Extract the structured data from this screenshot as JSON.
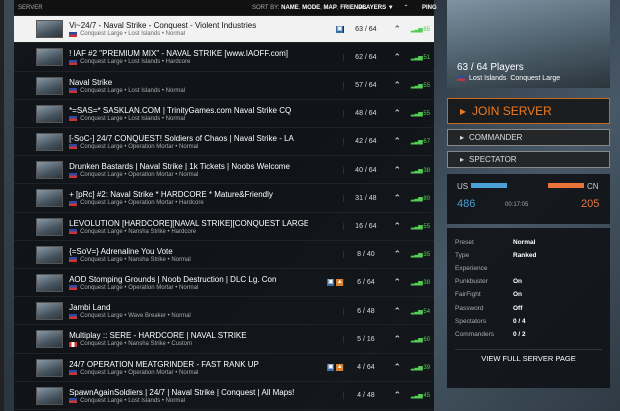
{
  "header": {
    "server_label": "SERVER",
    "sort_by": "SORT BY:",
    "sort_options": [
      "NAME",
      "MODE",
      "MAP",
      "FRIENDS"
    ],
    "players_label": "PLAYERS ▼",
    "ping_label": "PING"
  },
  "servers": [
    {
      "name": "Vi~24/7 - Naval Strike - Conquest - Violent Industries",
      "sub": "Conquest Large • Lost Islands • Normal",
      "players": "63 / 64",
      "ping": "85",
      "icons": [
        "b"
      ],
      "flag": "us"
    },
    {
      "name": "! IAF #2 \"PREMIUM MIX\" - NAVAL STRIKE [www.IAOFF.com]",
      "sub": "Conquest Large • Lost Islands • Hardcore",
      "players": "62 / 64",
      "ping": "51",
      "icons": [],
      "flag": "us"
    },
    {
      "name": "Naval Strike",
      "sub": "Conquest Large • Lost Islands • Normal",
      "players": "57 / 64",
      "ping": "55",
      "icons": [],
      "flag": "us"
    },
    {
      "name": "*=SAS=* SASKLAN.COM | TrinityGames.com Naval Strike CQ",
      "sub": "Conquest Large • Lost Islands • Normal",
      "players": "48 / 64",
      "ping": "55",
      "icons": [],
      "flag": "us"
    },
    {
      "name": "[-SoC-] 24/7 CONQUEST! Soldiers of Chaos | Naval Strike - LA",
      "sub": "Conquest Large • Operation Mortar • Normal",
      "players": "42 / 64",
      "ping": "67",
      "icons": [],
      "flag": "us"
    },
    {
      "name": "Drunken Bastards | Naval Strike | 1k Tickets | Noobs Welcome",
      "sub": "Conquest Large • Operation Mortar • Normal",
      "players": "40 / 64",
      "ping": "38",
      "icons": [],
      "flag": "us"
    },
    {
      "name": "+ [pRc] #2: Naval Strike * HARDCORE * Mature&Friendly",
      "sub": "Conquest Large • Operation Mortar • Hardcore",
      "players": "31 / 48",
      "ping": "80",
      "icons": [],
      "flag": "us"
    },
    {
      "name": "LEVOLUTION [HARDCORE][NAVAL STRIKE][CONQUEST LARGE]",
      "sub": "Conquest Large • Nansha Strike • Hardcore",
      "players": "16 / 64",
      "ping": "55",
      "icons": [],
      "flag": "us"
    },
    {
      "name": "{=SoV=} Adrenaline You Vote",
      "sub": "Conquest Large • Nansha Strike • Normal",
      "players": "8 / 40",
      "ping": "35",
      "icons": [],
      "flag": "us"
    },
    {
      "name": "AOD Stomping Grounds | Noob Destruction | DLC Lg. Con",
      "sub": "Conquest Large • Operation Mortar • Normal",
      "players": "6 / 64",
      "ping": "38",
      "icons": [
        "b",
        "o"
      ],
      "flag": "us"
    },
    {
      "name": "Jambi Land",
      "sub": "Conquest Large • Wave Breaker • Normal",
      "players": "6 / 48",
      "ping": "54",
      "icons": [],
      "flag": "us"
    },
    {
      "name": "Multiplay :: SERE - HARDCORE | NAVAL STRIKE",
      "sub": "Conquest Large • Nansha Strike • Custom",
      "players": "5 / 16",
      "ping": "60",
      "icons": [],
      "flag": "ca"
    },
    {
      "name": "24/7 OPERATION MEATGRINDER - FAST RANK UP",
      "sub": "Conquest Large • Operation Mortar • Normal",
      "players": "4 / 64",
      "ping": "39",
      "icons": [
        "b",
        "o"
      ],
      "flag": "us"
    },
    {
      "name": "SpawnAgainSoldiers | 24/7 | Naval Strike | Conquest | All Maps!",
      "sub": "Conquest Large • Lost Islands • Normal",
      "players": "4 / 48",
      "ping": "45",
      "icons": [],
      "flag": "us"
    }
  ],
  "side": {
    "player_count": "63 / 64 Players",
    "map": "Lost Islands",
    "mode": "Conquest Large",
    "join_label": "JOIN SERVER",
    "commander_label": "COMMANDER",
    "spectator_label": "SPECTATOR",
    "team1": "US",
    "team2": "CN",
    "score1": "486",
    "score2": "205",
    "clock": "00:17:05",
    "us_color": "#4a9fd8",
    "cn_color": "#e8743a",
    "info": [
      {
        "k": "Preset",
        "v": "Normal"
      },
      {
        "k": "Type",
        "v": "Ranked"
      },
      {
        "k": "Experience",
        "v": ""
      },
      {
        "k": "Punkbuster",
        "v": "On"
      },
      {
        "k": "FairFight",
        "v": "On"
      },
      {
        "k": "Password",
        "v": "Off"
      },
      {
        "k": "Spectators",
        "v": "0 / 4"
      },
      {
        "k": "Commanders",
        "v": "0 / 2"
      }
    ],
    "view_full": "VIEW FULL SERVER PAGE"
  }
}
